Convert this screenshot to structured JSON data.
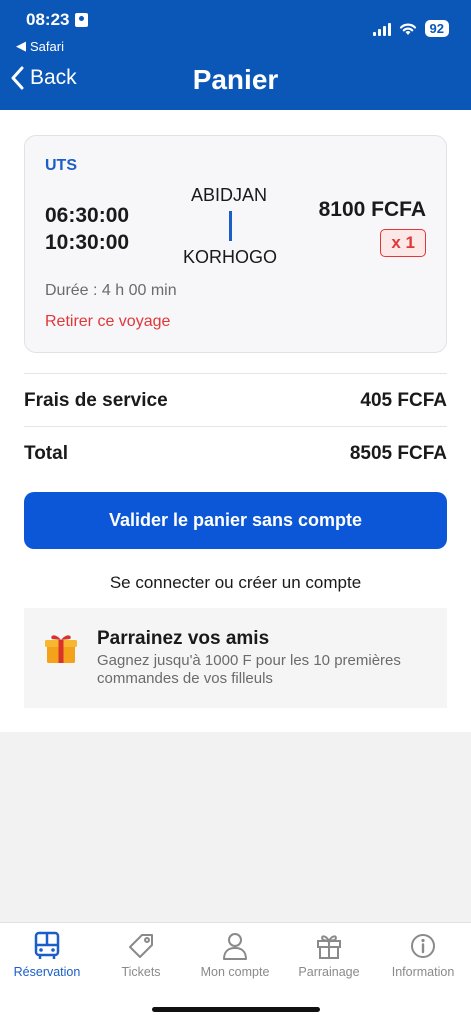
{
  "status": {
    "time": "08:23",
    "back_app": "Safari",
    "battery": "92"
  },
  "nav": {
    "back_label": "Back",
    "title": "Panier"
  },
  "trip": {
    "company": "UTS",
    "departure_time": "06:30:00",
    "arrival_time": "10:30:00",
    "from": "ABIDJAN",
    "to": "KORHOGO",
    "price": "8100 FCFA",
    "quantity": "x 1",
    "duration": "Durée : 4 h 00 min",
    "remove_label": "Retirer ce voyage"
  },
  "summary": {
    "service_label": "Frais de service",
    "service_value": "405 FCFA",
    "total_label": "Total",
    "total_value": "8505 FCFA"
  },
  "actions": {
    "validate_label": "Valider le panier sans compte",
    "login_label": "Se connecter ou créer un compte"
  },
  "referral": {
    "title": "Parrainez vos amis",
    "text": "Gagnez jusqu'à 1000 F pour les 10 premières commandes de vos filleuls"
  },
  "tabs": [
    {
      "label": "Réservation",
      "icon": "bus-icon"
    },
    {
      "label": "Tickets",
      "icon": "tag-icon"
    },
    {
      "label": "Mon compte",
      "icon": "user-icon"
    },
    {
      "label": "Parrainage",
      "icon": "gift-icon"
    },
    {
      "label": "Information",
      "icon": "info-icon"
    }
  ],
  "colors": {
    "primary": "#0b57b7",
    "accent": "#1b5ec7",
    "danger": "#e0373a"
  }
}
